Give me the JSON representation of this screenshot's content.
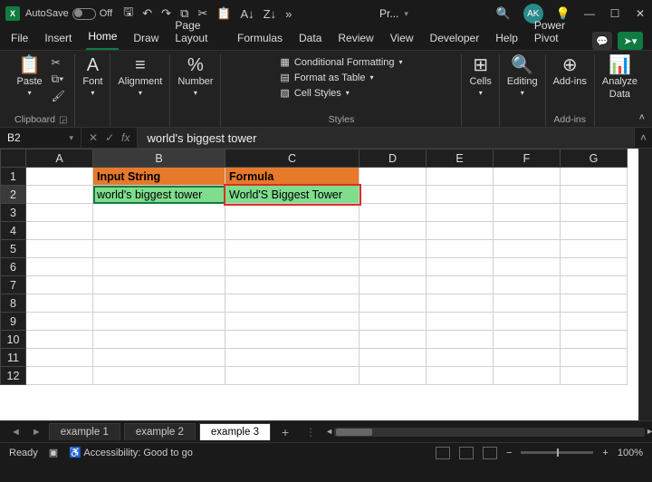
{
  "titlebar": {
    "app_icon_text": "X",
    "autosave_label": "AutoSave",
    "autosave_state": "Off",
    "doc_name": "Pr...",
    "avatar_initials": "AK"
  },
  "tabs": {
    "items": [
      "File",
      "Insert",
      "Home",
      "Draw",
      "Page Layout",
      "Formulas",
      "Data",
      "Review",
      "View",
      "Developer",
      "Help",
      "Power Pivot"
    ],
    "active_index": 2
  },
  "ribbon": {
    "clipboard": {
      "paste": "Paste",
      "label": "Clipboard"
    },
    "font": {
      "label": "Font"
    },
    "alignment": {
      "label": "Alignment"
    },
    "number": {
      "label": "Number"
    },
    "styles": {
      "conditional": "Conditional Formatting",
      "table": "Format as Table",
      "cellstyles": "Cell Styles",
      "label": "Styles"
    },
    "cells": {
      "label": "Cells"
    },
    "editing": {
      "label": "Editing"
    },
    "addins": {
      "label": "Add-ins"
    },
    "analyze": {
      "line1": "Analyze",
      "line2": "Data"
    }
  },
  "formula_bar": {
    "name_box": "B2",
    "fx_label": "fx",
    "formula": "world's biggest tower"
  },
  "grid": {
    "columns": [
      "A",
      "B",
      "C",
      "D",
      "E",
      "F",
      "G"
    ],
    "rows": [
      1,
      2,
      3,
      4,
      5,
      6,
      7,
      8,
      9,
      10,
      11,
      12
    ],
    "selected_cell": "B2",
    "cells": {
      "B1": "Input String",
      "C1": "Formula",
      "B2": "world's biggest tower",
      "C2": "World'S Biggest Tower"
    }
  },
  "sheet_tabs": {
    "items": [
      "example 1",
      "example 2",
      "example 3"
    ],
    "active_index": 2
  },
  "status": {
    "ready": "Ready",
    "accessibility": "Accessibility: Good to go",
    "zoom": "100%"
  }
}
